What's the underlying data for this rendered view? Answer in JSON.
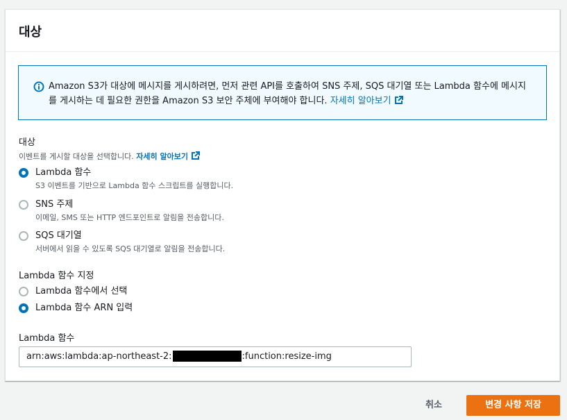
{
  "panel": {
    "title": "대상"
  },
  "info": {
    "text": "Amazon S3가 대상에 메시지를 게시하려면, 먼저 관련 API를 호출하여 SNS 주제, SQS 대기열 또는 Lambda 함수에 메시지를 게시하는 데 필요한 권한을 Amazon S3 보안 주체에 부여해야 합니다.",
    "link": "자세히 알아보기",
    "icon": "info-icon",
    "link_icon": "external-link-icon"
  },
  "destination": {
    "label": "대상",
    "description": "이벤트를 게시할 대상을 선택합니다.",
    "link": "자세히 알아보기",
    "options": [
      {
        "label": "Lambda 함수",
        "description": "S3 이벤트를 기반으로 Lambda 함수 스크립트를 실행합니다.",
        "checked": true
      },
      {
        "label": "SNS 주제",
        "description": "이메일, SMS 또는 HTTP 엔드포인트로 알림을 전송합니다.",
        "checked": false
      },
      {
        "label": "SQS 대기열",
        "description": "서버에서 읽을 수 있도록 SQS 대기열로 알림을 전송합니다.",
        "checked": false
      }
    ]
  },
  "lambda_spec": {
    "label": "Lambda 함수 지정",
    "options": [
      {
        "label": "Lambda 함수에서 선택",
        "checked": false
      },
      {
        "label": "Lambda 함수 ARN 입력",
        "checked": true
      }
    ]
  },
  "lambda_function": {
    "label": "Lambda 함수",
    "value_prefix": "arn:aws:lambda:ap-northeast-2:",
    "value_suffix": ":function:resize-img"
  },
  "actions": {
    "cancel": "취소",
    "save": "변경 사항 저장"
  },
  "colors": {
    "accent": "#0073bb",
    "primary_button": "#ec7211"
  }
}
